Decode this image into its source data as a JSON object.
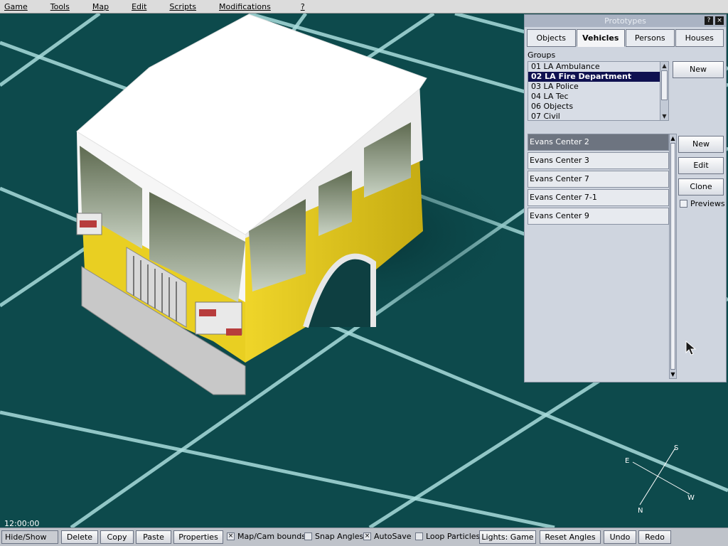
{
  "menu": [
    "Game",
    "Tools",
    "Map",
    "Edit",
    "Scripts",
    "Modifications",
    "?"
  ],
  "viewport": {
    "clock": "12:00:00",
    "compass": {
      "n": "N",
      "s": "S",
      "e": "E",
      "w": "W"
    }
  },
  "panel": {
    "title": "Prototypes",
    "help_icon": "?",
    "close_icon": "×",
    "tabs": [
      {
        "label": "Objects",
        "active": false
      },
      {
        "label": "Vehicles",
        "active": true
      },
      {
        "label": "Persons",
        "active": false
      },
      {
        "label": "Houses",
        "active": false
      }
    ],
    "groups_label": "Groups",
    "groups": [
      {
        "label": "01 LA Ambulance",
        "selected": false
      },
      {
        "label": "02 LA Fire Department",
        "selected": true
      },
      {
        "label": "03 LA Police",
        "selected": false
      },
      {
        "label": "04 LA Tec",
        "selected": false
      },
      {
        "label": "06 Objects",
        "selected": false
      },
      {
        "label": "07 Civil",
        "selected": false
      }
    ],
    "group_new_label": "New",
    "prototypes": [
      {
        "label": "Evans Center 2",
        "selected": true
      },
      {
        "label": "Evans Center 3",
        "selected": false
      },
      {
        "label": "Evans Center 7",
        "selected": false
      },
      {
        "label": "Evans Center 7-1",
        "selected": false
      },
      {
        "label": "Evans Center 9",
        "selected": false
      }
    ],
    "proto_new_label": "New",
    "edit_label": "Edit",
    "clone_label": "Clone",
    "previews_label": "Previews"
  },
  "toolbar": {
    "hide_show": "Hide/Show",
    "delete": "Delete",
    "copy": "Copy",
    "paste": "Paste",
    "properties": "Properties",
    "map_cam_bounds": "Map/Cam bounds",
    "snap_angles": "Snap Angles",
    "autosave": "AutoSave",
    "loop_particles": "Loop Particles",
    "lights": "Lights: Game",
    "reset_angles": "Reset Angles",
    "undo": "Undo",
    "redo": "Redo",
    "check_mark": "×"
  },
  "colors": {
    "ground": "#0d4a4c",
    "grid": "#a9dcdc",
    "truck_yellow": "#e3c820",
    "truck_white": "#f4f4f4"
  }
}
